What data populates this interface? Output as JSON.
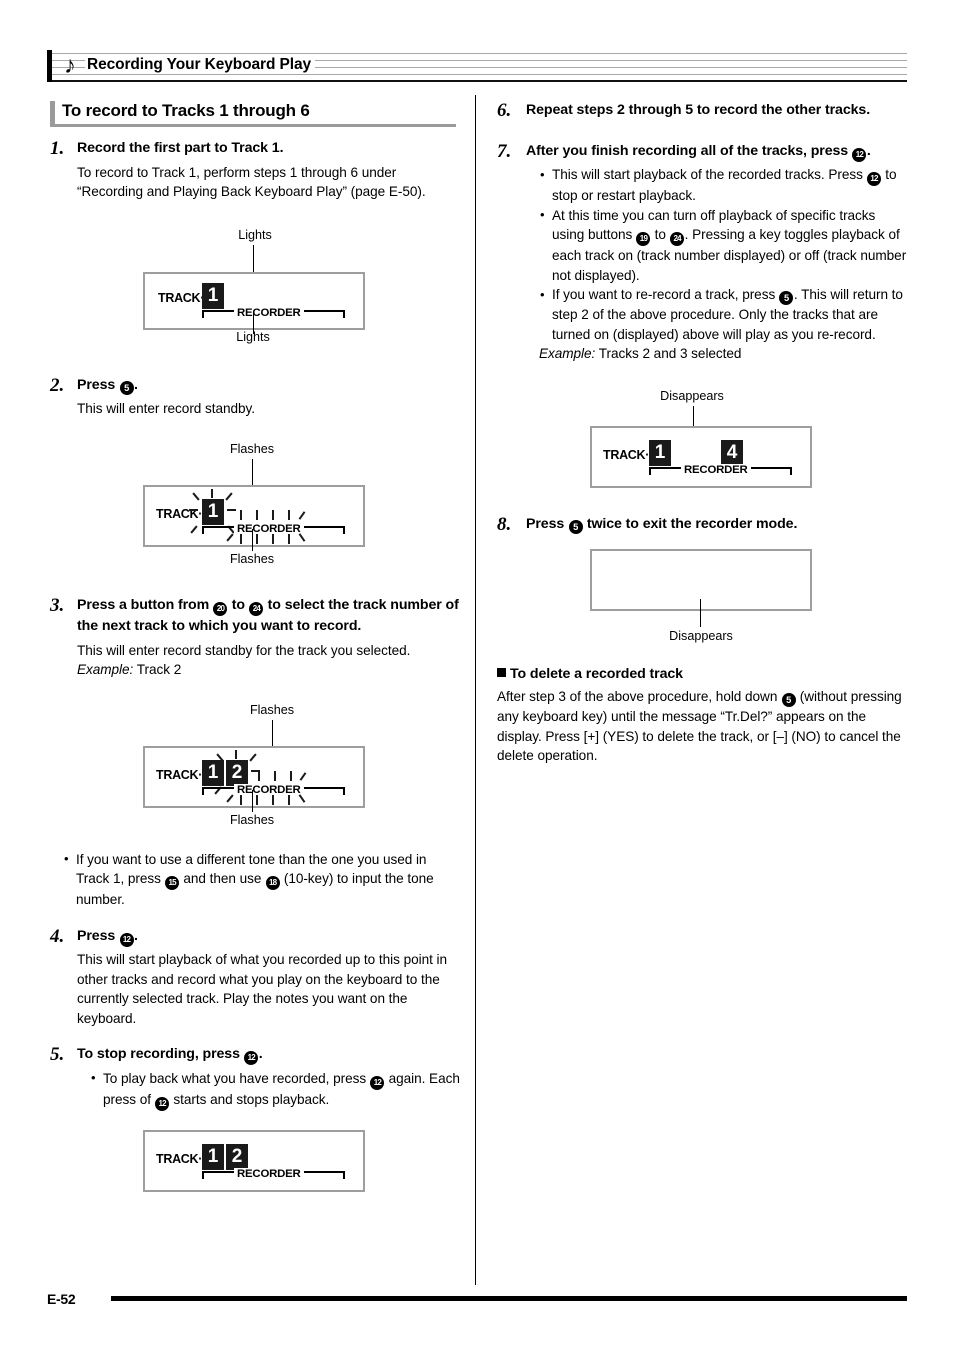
{
  "header": {
    "note_icon": "eighth-note",
    "title": "Recording Your Keyboard Play"
  },
  "section": {
    "heading": "To record to Tracks 1 through 6"
  },
  "steps": {
    "s1": {
      "num": "1.",
      "title": "Record the first part to Track 1.",
      "body": "To record to Track 1, perform steps 1 through 6 under “Recording and Playing Back Keyboard Play” (page E-50)."
    },
    "s2": {
      "num": "2.",
      "title_pre": "Press ",
      "badge": "5",
      "title_post": ".",
      "body": "This will enter record standby."
    },
    "s3": {
      "num": "3.",
      "title_pre": "Press a button from ",
      "badge_a": "20",
      "title_mid": " to ",
      "badge_b": "24",
      "title_post": " to select the track number of the next track to which you want to record.",
      "body": "This will enter record standby for the track you selected.",
      "example_label": "Example:",
      "example_value": " Track 2",
      "bullet_pre": "If you want to use a different tone than the one you used in Track 1, press ",
      "bullet_badge_a": "15",
      "bullet_mid": " and then use ",
      "bullet_badge_b": "18",
      "bullet_post": " (10-key) to input the tone number."
    },
    "s4": {
      "num": "4.",
      "title_pre": "Press ",
      "badge": "12",
      "title_post": ".",
      "body": "This will start playback of what you recorded up to this point in other tracks and record what you play on the keyboard to the currently selected track. Play the notes you want on the keyboard."
    },
    "s5": {
      "num": "5.",
      "title_pre": "To stop recording, press ",
      "badge": "12",
      "title_post": ".",
      "bullet_pre": "To play back what you have recorded, press ",
      "bullet_badge_a": "12",
      "bullet_mid": " again. Each press of ",
      "bullet_badge_b": "12",
      "bullet_post": " starts and stops playback."
    },
    "s6": {
      "num": "6.",
      "title": "Repeat steps 2 through 5 to record the other tracks."
    },
    "s7": {
      "num": "7.",
      "title_pre": "After you finish recording all of the tracks, press ",
      "badge": "12",
      "title_post": ".",
      "b1_pre": "This will start playback of the recorded tracks. Press ",
      "b1_badge": "12",
      "b1_post": " to stop or restart playback.",
      "b2_pre": "At this time you can turn off playback of specific tracks using buttons ",
      "b2_badge_a": "19",
      "b2_mid": " to ",
      "b2_badge_b": "24",
      "b2_post": ". Pressing a key toggles playback of each track on (track number displayed) or off (track number not displayed).",
      "b3_pre": "If you want to re-record a track, press ",
      "b3_badge": "5",
      "b3_post": ". This will return to step 2 of the above procedure. Only the tracks that are turned on (displayed) above will play as you re-record.",
      "example_label": "Example:",
      "example_value": " Tracks 2 and 3 selected"
    },
    "s8": {
      "num": "8.",
      "title_pre": "Press ",
      "badge": "5",
      "title_post": " twice to exit the recorder mode."
    }
  },
  "delete_section": {
    "heading": "To delete a recorded track",
    "body_pre": "After step 3 of the above procedure, hold down ",
    "badge": "5",
    "body_post": " (without pressing any keyboard key) until the message “Tr.Del?” appears on the display. Press [+] (YES) to delete the track, or [–] (NO) to cancel the delete operation."
  },
  "figures": {
    "fig1": {
      "caption_top": "Lights",
      "caption_bottom": "Lights",
      "track_label": "TRACK·",
      "recorder_label": "RECORDER",
      "numbers": [
        "1"
      ]
    },
    "fig2": {
      "caption_top": "Flashes",
      "caption_bottom": "Flashes",
      "track_label": "TRACK·",
      "recorder_label": "RECORDER",
      "numbers": [
        "1"
      ]
    },
    "fig3": {
      "caption_top": "Flashes",
      "caption_bottom": "Flashes",
      "track_label": "TRACK·",
      "recorder_label": "RECORDER",
      "numbers": [
        "1",
        "2"
      ]
    },
    "fig4": {
      "track_label": "TRACK·",
      "recorder_label": "RECORDER",
      "numbers": [
        "1",
        "2"
      ]
    },
    "fig5": {
      "caption_top": "Disappears",
      "track_label": "TRACK·",
      "recorder_label": "RECORDER",
      "numbers": [
        "1",
        "4"
      ]
    },
    "fig6": {
      "caption_bottom": "Disappears"
    }
  },
  "footer": {
    "page": "E-52"
  }
}
